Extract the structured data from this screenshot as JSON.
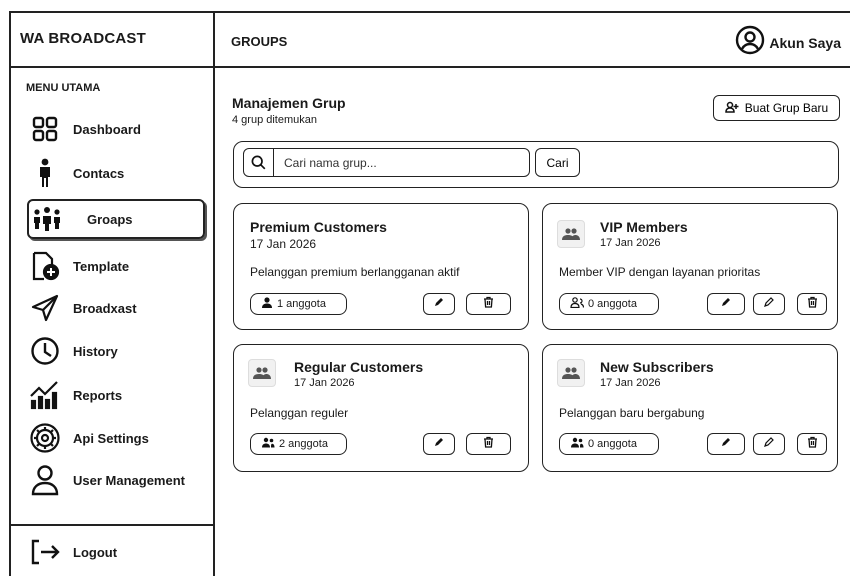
{
  "app": {
    "brand": "WA BROADCAST"
  },
  "header": {
    "title": "GROUPS",
    "account_label": "Akun Saya"
  },
  "sidebar": {
    "section_title": "MENU UTAMA",
    "items": [
      {
        "label": "Dashboard",
        "icon": "grid-icon"
      },
      {
        "label": "Contacs",
        "icon": "person-icon"
      },
      {
        "label": "Groaps",
        "icon": "group-icon",
        "active": true
      },
      {
        "label": "Template",
        "icon": "template-add-icon"
      },
      {
        "label": "Broadxast",
        "icon": "send-icon"
      },
      {
        "label": "History",
        "icon": "clock-icon"
      },
      {
        "label": "Reports",
        "icon": "chart-icon"
      },
      {
        "label": "Api Settings",
        "icon": "gear-icon"
      },
      {
        "label": "User Management",
        "icon": "user-icon"
      }
    ],
    "logout_label": "Logout"
  },
  "main": {
    "title": "Manajemen Grup",
    "subtitle": "4 grup ditemukan",
    "new_button_label": "Buat Grup Baru",
    "search": {
      "placeholder": "Cari nama grup...",
      "button_label": "Cari"
    },
    "groups": [
      {
        "name": "Premium Customers",
        "date": "17 Jan 2026",
        "description": "Pelanggan premium berlangganan aktif",
        "members": "1 anggota"
      },
      {
        "name": "VIP Members",
        "date": "17 Jan 2026",
        "description": "Member VIP dengan layanan prioritas",
        "members": "0 anggota"
      },
      {
        "name": "Regular Customers",
        "date": "17 Jan 2026",
        "description": "Pelanggan reguler",
        "members": "2 anggota"
      },
      {
        "name": "New Subscribers",
        "date": "17 Jan 2026",
        "description": "Pelanggan baru bergabung",
        "members": "0 anggota"
      }
    ]
  }
}
